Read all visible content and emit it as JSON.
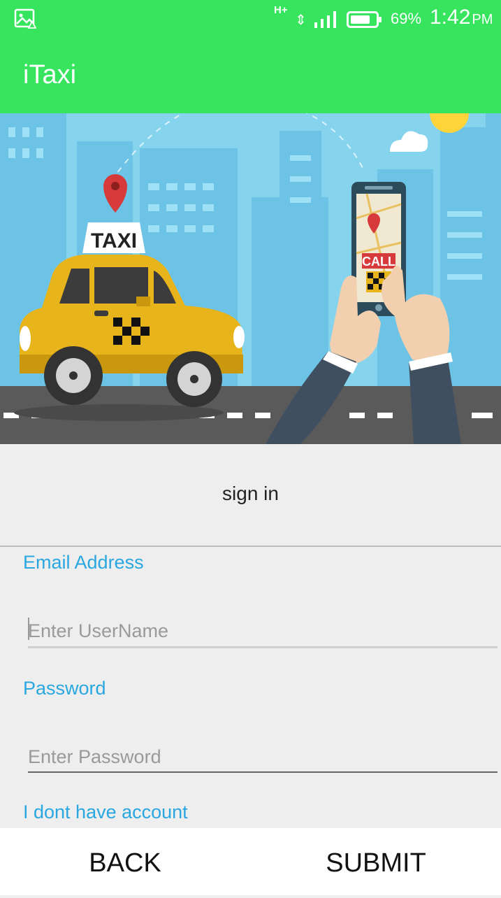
{
  "status_bar": {
    "network_type": "H+",
    "battery": "69%",
    "time": "1:42",
    "ampm": "PM"
  },
  "app_bar": {
    "title": "iTaxi"
  },
  "hero": {
    "taxi_sign": "TAXI",
    "phone_button": "CALL"
  },
  "form": {
    "title": "sign in",
    "email_label": "Email Address",
    "email_placeholder": "Enter UserName",
    "password_label": "Password",
    "password_placeholder": "Enter Password",
    "signup_link": "I dont have account"
  },
  "bottom_bar": {
    "back_label": "BACK",
    "submit_label": "SUBMIT"
  },
  "colors": {
    "primary": "#36e45e",
    "accent": "#2aa7e0",
    "background": "#eeeeee"
  }
}
